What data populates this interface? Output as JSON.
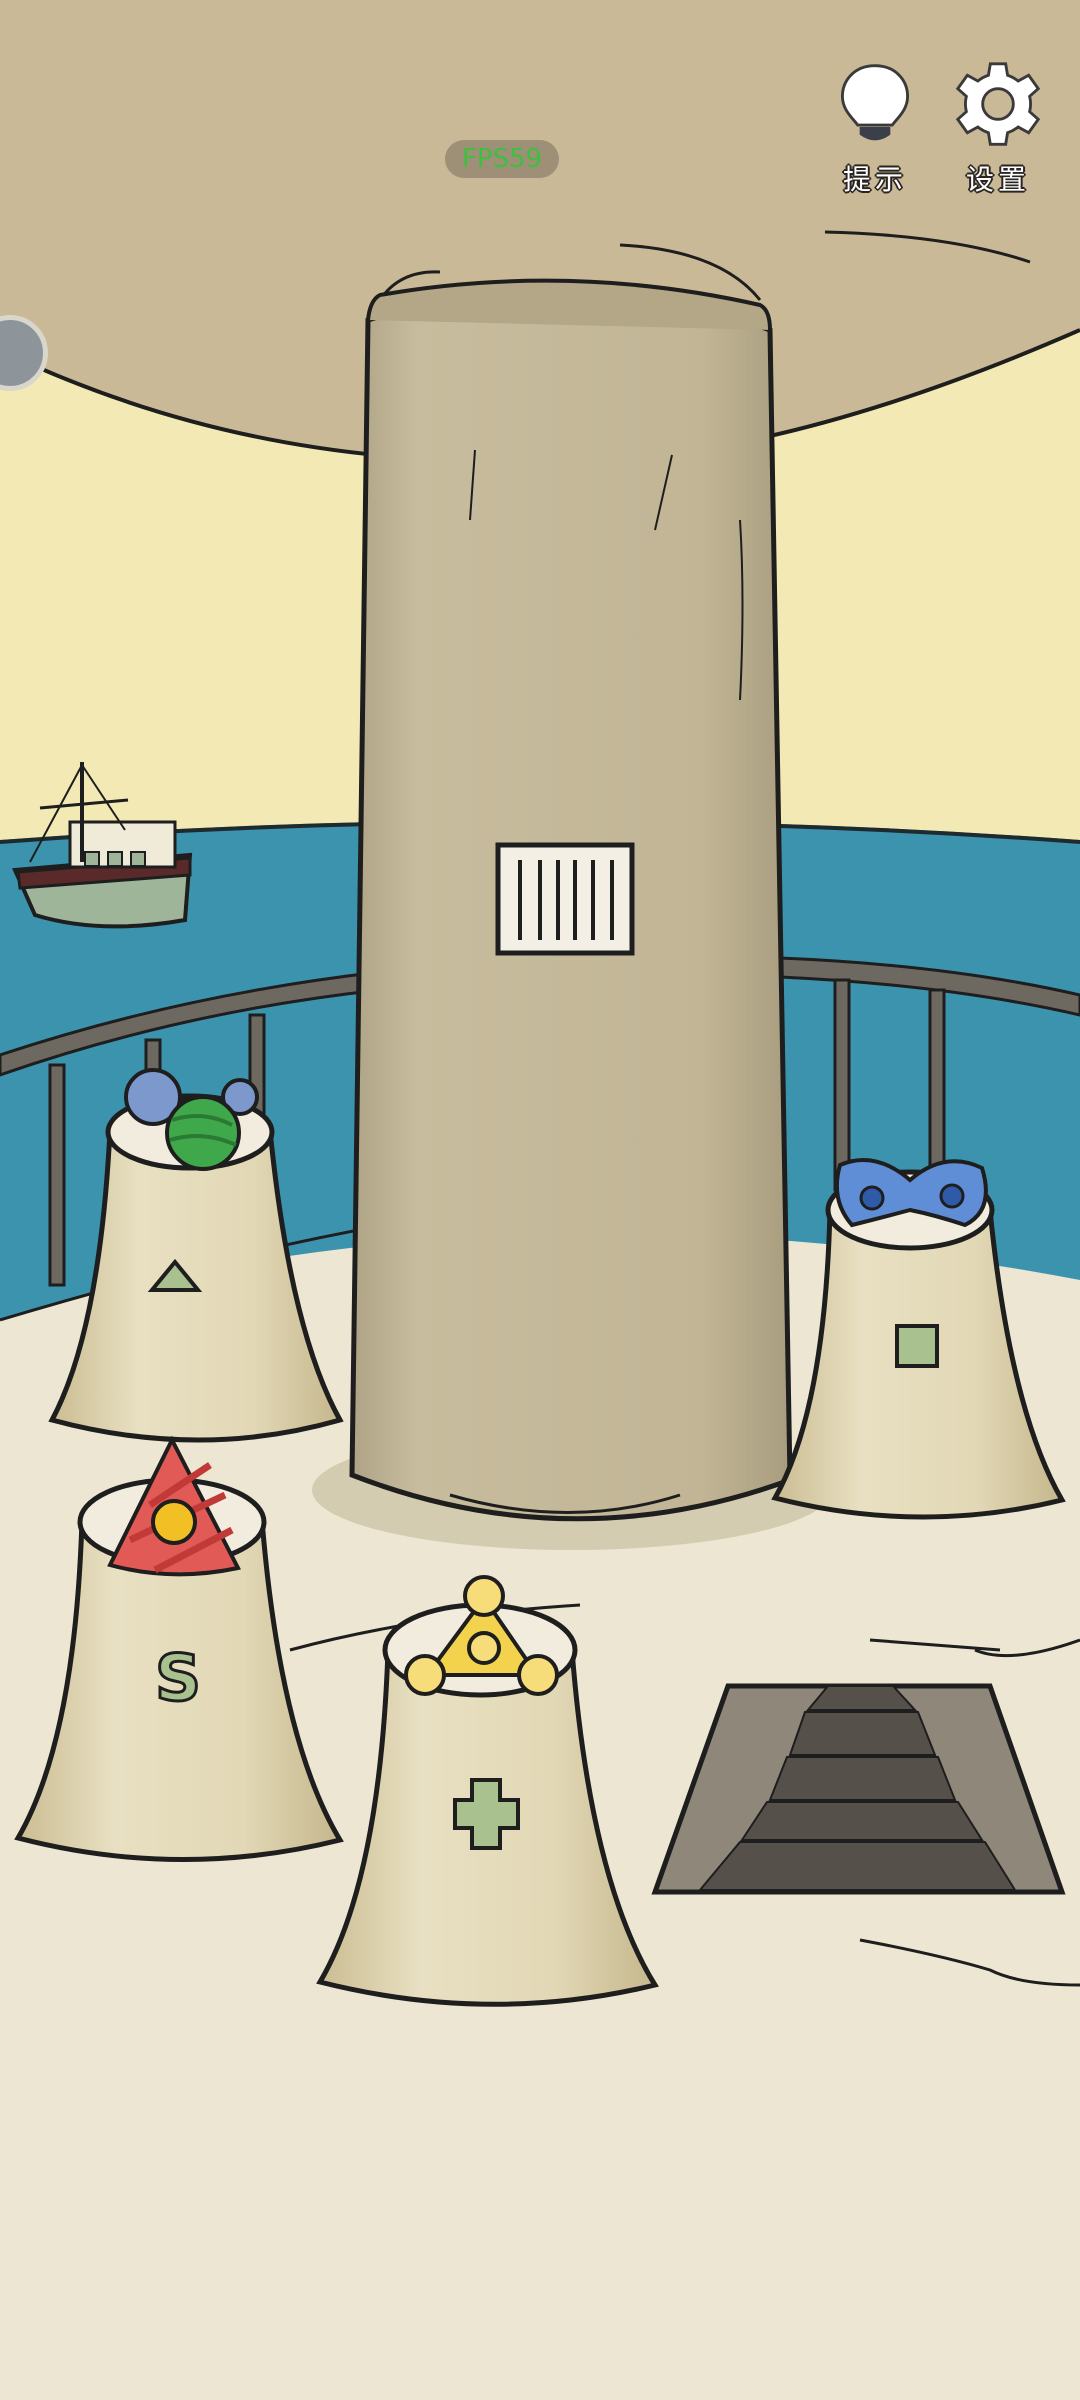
{
  "hud": {
    "fps_label": "FPS59",
    "fps_color": "#3fbf3f",
    "hint_label": "提示",
    "settings_label": "设置",
    "hint_icon": "lightbulb-icon",
    "settings_icon": "gear-icon"
  },
  "scene": {
    "background": "lighthouse-gallery",
    "pedestals": [
      {
        "name": "triangle",
        "symbol": "△",
        "item": "balls-cluster"
      },
      {
        "name": "square",
        "symbol": "□",
        "item": "blue-bowtie"
      },
      {
        "name": "s",
        "symbol": "S",
        "item": "red-triangle"
      },
      {
        "name": "plus",
        "symbol": "+",
        "item": "yellow-triangle-beads"
      }
    ],
    "colors": {
      "sky": "#f3e9b4",
      "sea": "#3c93ad",
      "ceiling": "#c9b997",
      "floor": "#ece6d2",
      "pillar": "#bcb092",
      "pedestal": "#d8cda8"
    }
  }
}
